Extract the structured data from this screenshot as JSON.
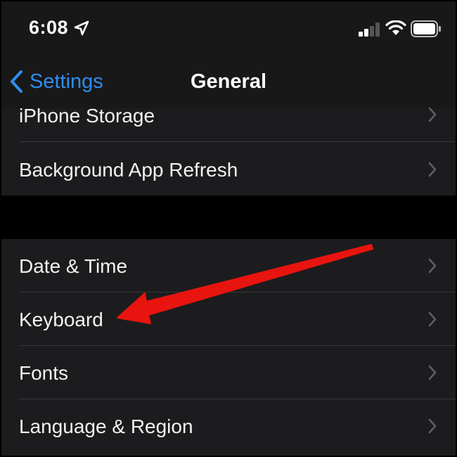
{
  "status_bar": {
    "time": "6:08",
    "icons": [
      "location-arrow-icon",
      "cellular-signal-icon",
      "wifi-icon",
      "battery-icon"
    ]
  },
  "nav": {
    "back_label": "Settings",
    "back_icon": "chevron-left-icon",
    "title": "General"
  },
  "groups": [
    {
      "items": [
        {
          "label": "iPhone Storage",
          "icon": "chevron-right-icon"
        },
        {
          "label": "Background App Refresh",
          "icon": "chevron-right-icon"
        }
      ]
    },
    {
      "items": [
        {
          "label": "Date & Time",
          "icon": "chevron-right-icon"
        },
        {
          "label": "Keyboard",
          "icon": "chevron-right-icon"
        },
        {
          "label": "Fonts",
          "icon": "chevron-right-icon"
        },
        {
          "label": "Language & Region",
          "icon": "chevron-right-icon"
        }
      ]
    }
  ],
  "annotation": {
    "type": "arrow",
    "color": "#e8140f",
    "points_to": "Keyboard"
  },
  "colors": {
    "accent": "#2f8df0",
    "background": "#1c1c1e",
    "bar_background": "#181818",
    "separator_gap": "#000000"
  }
}
